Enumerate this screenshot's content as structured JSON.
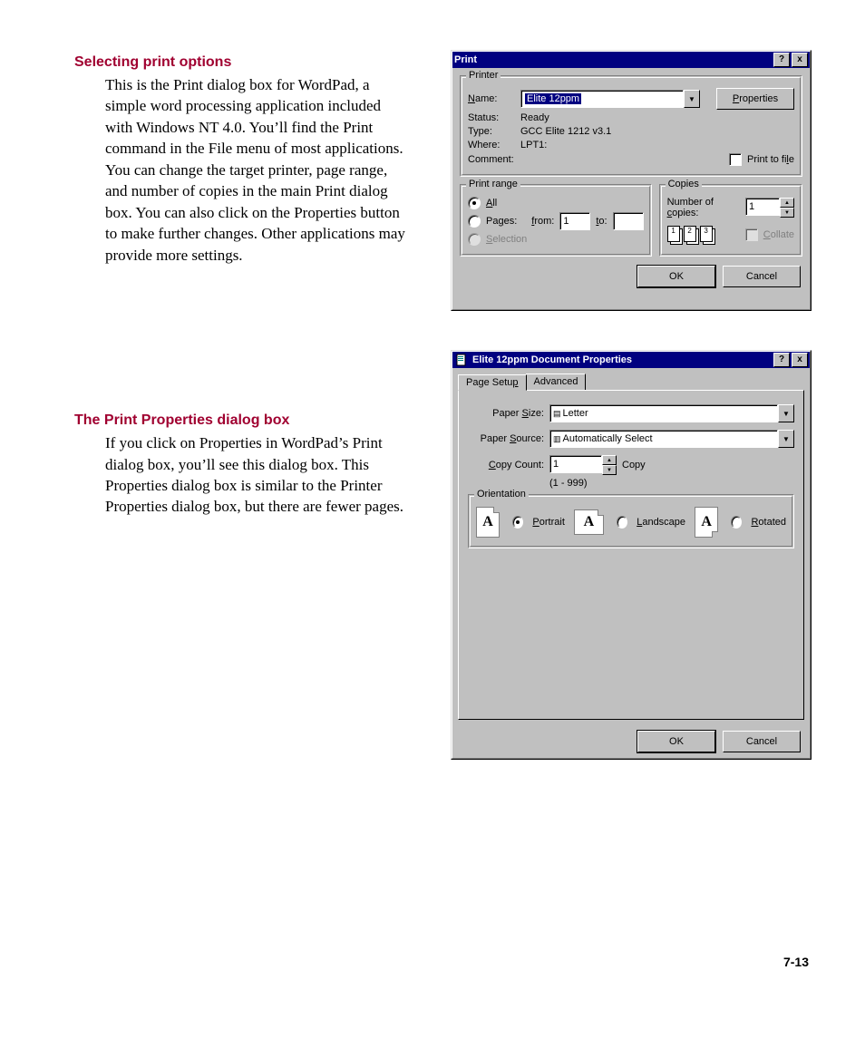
{
  "doc": {
    "heading1": "Selecting print options",
    "para1": "This is the Print dialog box for WordPad, a simple word processing application included with Windows NT 4.0. You’ll find the Print command in the File menu of most applications. You can change the target printer, page range, and number of copies in the main Print dialog box. You can also click on the Properties button to make further changes. Other applications may provide more settings.",
    "heading2": "The Print Properties dialog box",
    "para2": "If you click on Properties in WordPad’s Print dialog box, you’ll see this dialog box. This Properties dialog box is similar to the Printer Properties dialog box, but there are fewer pages.",
    "pagenum": "7-13"
  },
  "printDlg": {
    "title": "Print",
    "helpGlyph": "?",
    "closeGlyph": "x",
    "printerGroup": "Printer",
    "nameLabelPre": "N",
    "nameLabelPost": "ame:",
    "printerName": "Elite 12ppm",
    "propertiesPre": "P",
    "propertiesPost": "roperties",
    "statusLabel": "Status:",
    "statusValue": "Ready",
    "typeLabel": "Type:",
    "typeValue": "GCC Elite 1212 v3.1",
    "whereLabel": "Where:",
    "whereValue": "LPT1:",
    "commentLabel": "Comment:",
    "printToFilePre": "l",
    "printToFileFull": "Print to fi",
    "rangeGroup": "Print range",
    "allPre": "A",
    "allPost": "ll",
    "pagesPre": "g",
    "pagesFull": "Pa",
    "pagesTail": "es:",
    "fromPre": "f",
    "fromPost": "rom:",
    "fromValue": "1",
    "toPre": "t",
    "toPost": "o:",
    "selectionPre": "S",
    "selectionPost": "election",
    "copiesGroup": "Copies",
    "numCopiesPre": "c",
    "numCopiesFull": "Number of ",
    "numCopiesTail": "opies:",
    "numCopiesValue": "1",
    "collatePre": "C",
    "collatePost": "ollate",
    "okLabel": "OK",
    "cancelLabel": "Cancel",
    "page1": "1",
    "page2": "2",
    "page3": "3"
  },
  "propDlg": {
    "title": "Elite 12ppm Document Properties",
    "helpGlyph": "?",
    "closeGlyph": "x",
    "tab1Pre": "P",
    "tab1Full": "age Setu",
    "tab1Post": "p",
    "tab2": "Advanced",
    "paperSizePre": "S",
    "paperSizeFull": "Paper ",
    "paperSizeTail": "ize:",
    "paperSizeValue": "Letter",
    "paperSourcePre": "S",
    "paperSourceFull": "Paper ",
    "paperSourceTail": "ource:",
    "paperSourceValue": "Automatically Select",
    "copyCountPre": "C",
    "copyCountFull": "opy Count:",
    "copyCountValue": "1",
    "copyUnit": "Copy",
    "copyRange": "(1 - 999)",
    "orientGroup": "Orientation",
    "portraitPre": "P",
    "portraitPost": "ortrait",
    "landscapePre": "L",
    "landscapePost": "andscape",
    "rotatedPre": "R",
    "rotatedPost": "otated",
    "glyphA": "A",
    "okLabel": "OK",
    "cancelLabel": "Cancel"
  }
}
